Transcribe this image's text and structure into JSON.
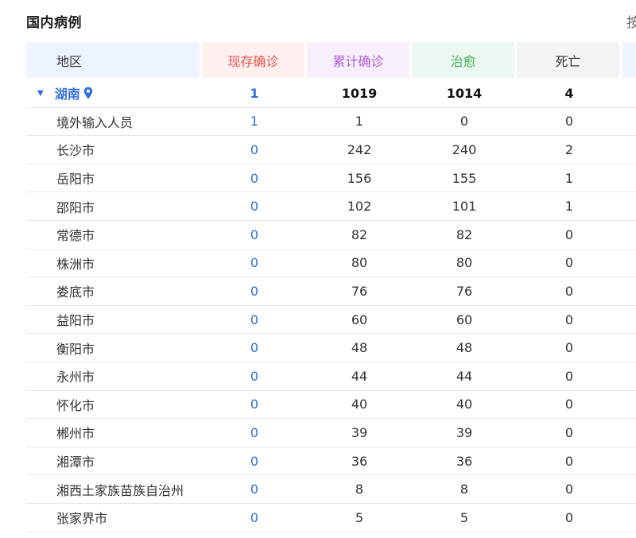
{
  "title": "国内病例",
  "cut_glyph": "按",
  "colors": {
    "current": "#e8554e",
    "total": "#b05fd6",
    "cured": "#3fad58",
    "death": "#333333",
    "link": "#2f6fde"
  },
  "header": {
    "region": "地区",
    "current": "现存确诊",
    "total": "累计确诊",
    "cured": "治愈",
    "death": "死亡"
  },
  "province": {
    "name": "湖南",
    "current": "1",
    "total": "1019",
    "cured": "1014",
    "death": "4",
    "icon": "location-pin-icon"
  },
  "rows": [
    {
      "region": "境外输入人员",
      "current": "1",
      "total": "1",
      "cured": "0",
      "death": "0"
    },
    {
      "region": "长沙市",
      "current": "0",
      "total": "242",
      "cured": "240",
      "death": "2"
    },
    {
      "region": "岳阳市",
      "current": "0",
      "total": "156",
      "cured": "155",
      "death": "1"
    },
    {
      "region": "邵阳市",
      "current": "0",
      "total": "102",
      "cured": "101",
      "death": "1"
    },
    {
      "region": "常德市",
      "current": "0",
      "total": "82",
      "cured": "82",
      "death": "0"
    },
    {
      "region": "株洲市",
      "current": "0",
      "total": "80",
      "cured": "80",
      "death": "0"
    },
    {
      "region": "娄底市",
      "current": "0",
      "total": "76",
      "cured": "76",
      "death": "0"
    },
    {
      "region": "益阳市",
      "current": "0",
      "total": "60",
      "cured": "60",
      "death": "0"
    },
    {
      "region": "衡阳市",
      "current": "0",
      "total": "48",
      "cured": "48",
      "death": "0"
    },
    {
      "region": "永州市",
      "current": "0",
      "total": "44",
      "cured": "44",
      "death": "0"
    },
    {
      "region": "怀化市",
      "current": "0",
      "total": "40",
      "cured": "40",
      "death": "0"
    },
    {
      "region": "郴州市",
      "current": "0",
      "total": "39",
      "cured": "39",
      "death": "0"
    },
    {
      "region": "湘潭市",
      "current": "0",
      "total": "36",
      "cured": "36",
      "death": "0"
    },
    {
      "region": "湘西土家族苗族自治州",
      "current": "0",
      "total": "8",
      "cured": "8",
      "death": "0"
    },
    {
      "region": "张家界市",
      "current": "0",
      "total": "5",
      "cured": "5",
      "death": "0"
    }
  ]
}
